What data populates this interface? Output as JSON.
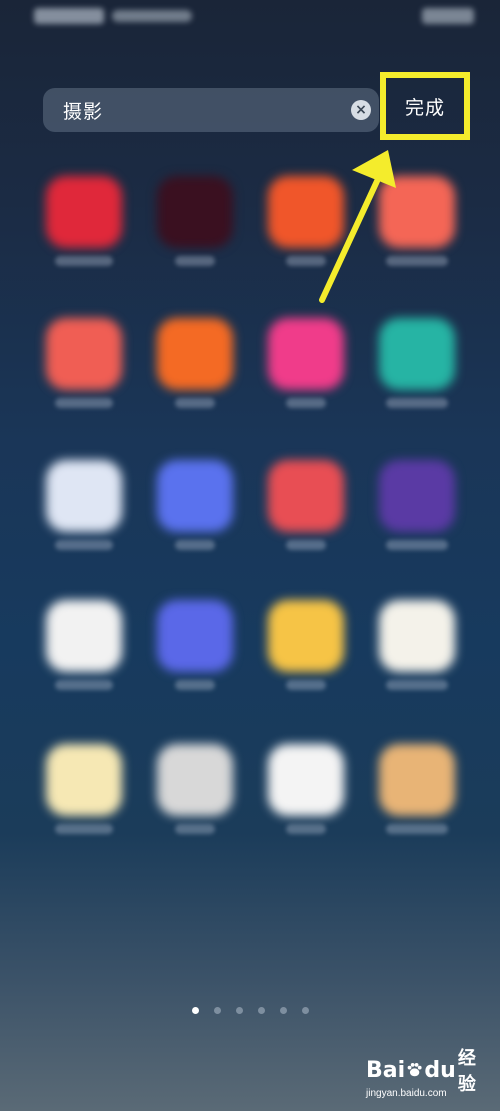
{
  "search": {
    "query": "摄影",
    "clear_icon": "clear-icon",
    "done_label": "完成",
    "highlight_color": "#f4ec2c"
  },
  "annotation": {
    "arrow_color": "#f4ec2c"
  },
  "apps": [
    {
      "color": "#e0283a"
    },
    {
      "color": "#3a1020"
    },
    {
      "color": "#f0562a"
    },
    {
      "color": "#f46656"
    },
    {
      "color": "#f05e54"
    },
    {
      "color": "#f46a24"
    },
    {
      "color": "#f03c8a"
    },
    {
      "color": "#26b4a4"
    },
    {
      "color": "#dfe6f4"
    },
    {
      "color": "#5a72ee"
    },
    {
      "color": "#e84e54"
    },
    {
      "color": "#5a3aa4"
    },
    {
      "color": "#f2f2f2"
    },
    {
      "color": "#5a68e8"
    },
    {
      "color": "#f6c446"
    },
    {
      "color": "#f4f2ea"
    },
    {
      "color": "#f6e8b4"
    },
    {
      "color": "#d8d8d8"
    },
    {
      "color": "#f4f4f4"
    },
    {
      "color": "#e8b476"
    }
  ],
  "pager": {
    "pages": 6,
    "active": 0
  },
  "watermark": {
    "brand_left": "Bai",
    "brand_right": "du",
    "brand_cn": "经验",
    "url": "jingyan.baidu.com"
  }
}
